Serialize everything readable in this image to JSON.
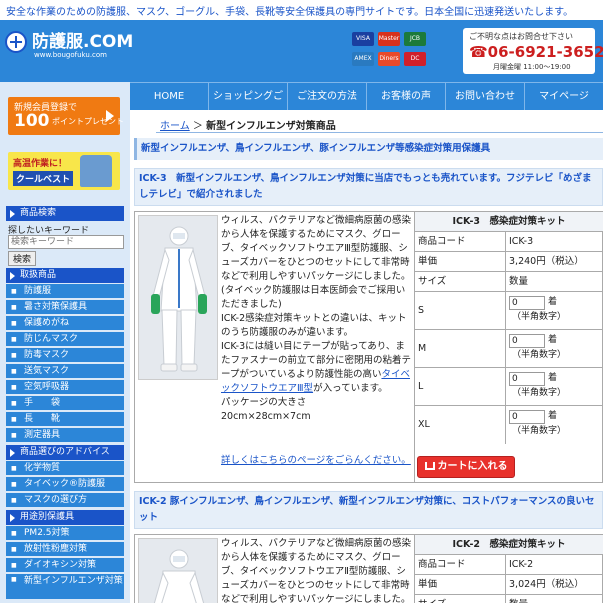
{
  "topbar": {
    "tagline": "安全な作業のための防護服、マスク、ゴーグル、手袋、長靴等安全保護具の専門サイトです。日本全国に迅速発送いたします。"
  },
  "header": {
    "logo": "防護服.COM",
    "url": "www.bougofuku.com",
    "cards": [
      "VISA",
      "Master",
      "JCB",
      "AMEX",
      "Diners",
      "DC"
    ],
    "phone_note": "ご不明な点はお問合せ下さい",
    "phone": "☎06-6921-3652",
    "hours": "月曜金曜 11:00〜19:00"
  },
  "nav": [
    "HOME",
    "ショッピングご",
    "ご注文の方法",
    "お客様の声",
    "お問い合わせ",
    "マイページ"
  ],
  "sidebar": {
    "banner_signup": {
      "line1": "新規会員登録で",
      "points": "100",
      "points_label": "ポイントプレゼント"
    },
    "banner_vest": {
      "line1": "高温作業に！",
      "line2": "クールベスト"
    },
    "search": {
      "title": "商品検索",
      "label": "探したいキーワード",
      "placeholder": "検索キーワード",
      "button": "検索"
    },
    "products_title": "取扱商品",
    "products": [
      "防護服",
      "暑さ対策保護具",
      "保護めがね",
      "防じんマスク",
      "防毒マスク",
      "送気マスク",
      "空気呼吸器",
      "手　　袋",
      "長　　靴",
      "測定器具"
    ],
    "advice_title": "商品選びのアドバイス",
    "advice": [
      "化学物質",
      "タイベック®防護服",
      "マスクの選び方"
    ],
    "purpose_title": "用途別保護具",
    "purpose": [
      "PM2.5対策",
      "放射性粉塵対策",
      "ダイオキシン対策",
      "新型インフルエンザ対策"
    ]
  },
  "breadcrumb": {
    "home": "ホーム",
    "separator": "＞",
    "current": "新型インフルエンザ対策商品"
  },
  "page_title": "新型インフルエンザ、鳥インフルエンザ、豚インフルエンザ等感染症対策用保護具",
  "products": [
    {
      "heading": "ICK-3　新型インフルエンザ、鳥インフルエンザ対策に当店でもっとも売れています。フジテレビ「めざましテレビ」で紹介されました",
      "desc_1": "ウィルス、バクテリアなど微細病原菌の感染から人体を保護するためにマスク、グローブ、タイベックソフトウエアⅢ型防護服、シューズカバーをひとつのセットにして非常時などで利用しやすいパッケージにしました。(タイベック防護服は日本医師会でご採用いただきました)",
      "desc_2": "ICK-2感染症対策キットとの違いは、キットのうち防護服のみが違います。",
      "desc_3": "ICK-3には縫い目にテープが貼ってあり、またファスナーの前立て部分に密閉用の粘着テープがついているより防護性能の高い",
      "desc_link": "タイベックソフトウエアⅢ型",
      "desc_4": "が入っています。",
      "desc_5": "パッケージの大きさ",
      "desc_6": "20cm×28cm×7cm",
      "more": "詳しくはこちらのページをごらんください。",
      "spec": {
        "name": "ICK-3　感染症対策キット",
        "code_label": "商品コード",
        "code": "ICK-3",
        "price_label": "単価",
        "price": "3,240円（税込）",
        "size_label": "サイズ",
        "qty_label": "数量",
        "sizes": [
          "S",
          "M",
          "L",
          "XL"
        ],
        "qty_value": "0",
        "unit": "着",
        "hint": "（半角数字）",
        "cart": "カートに入れる"
      }
    },
    {
      "heading": "ICK-2 豚インフルエンザ、鳥インフルエンザ、新型インフルエンザ対策に、コストパフォーマンスの良いセット",
      "desc_1": "ウィルス、バクテリアなど微細病原菌の感染から人体を保護するためにマスク、グローブ、タイベックソフトウエアⅡ型防護服、シューズカバーをひとつのセットにして非常時などで利用しやすいパッケージにしました。",
      "spec": {
        "name": "ICK-2　感染症対策キット",
        "code_label": "商品コード",
        "code": "ICK-2",
        "price_label": "単価",
        "price": "3,024円（税込）",
        "size_label": "サイズ",
        "qty_label": "数量"
      }
    }
  ]
}
